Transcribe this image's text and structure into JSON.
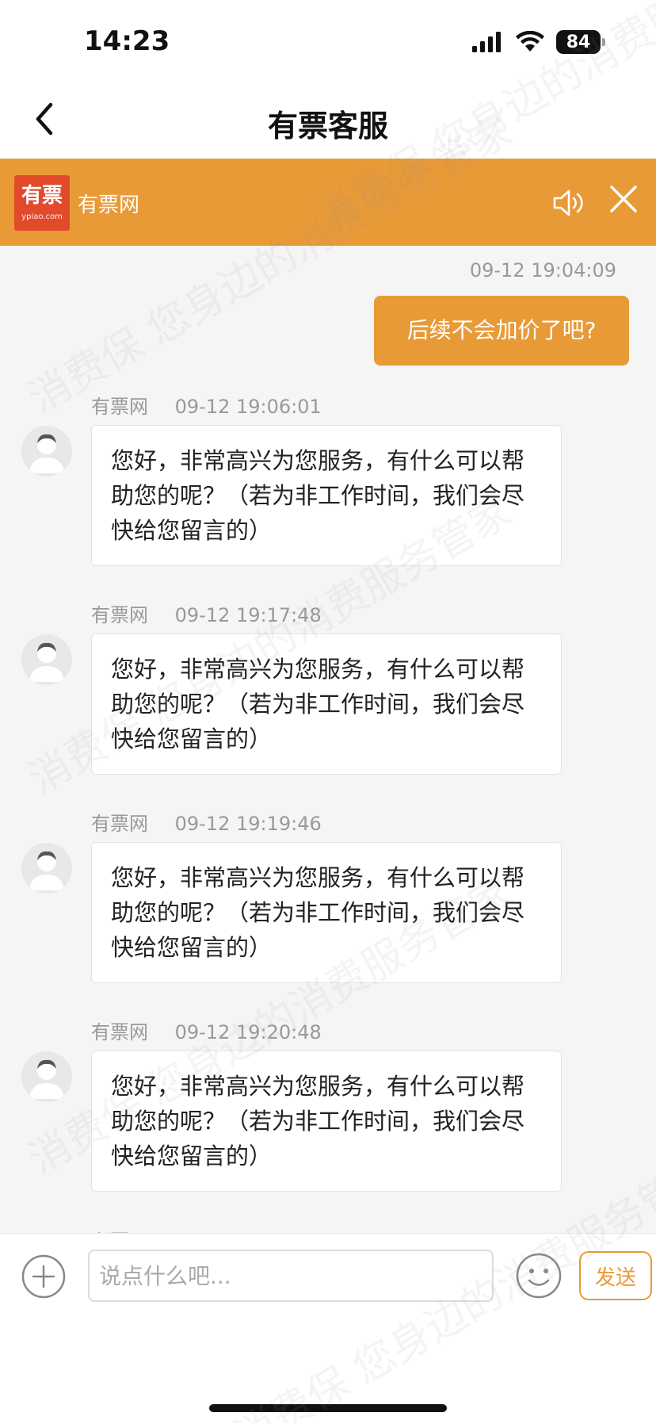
{
  "status": {
    "time": "14:23",
    "battery": "84"
  },
  "nav": {
    "title": "有票客服"
  },
  "banner": {
    "logo_text": "有票",
    "logo_sub": "ypiao.com",
    "name": "有票网"
  },
  "chat": {
    "own_message": {
      "time": "09-12 19:04:09",
      "text": "后续不会加价了吧?"
    },
    "replies": [
      {
        "sender": "有票网",
        "time": "09-12 19:06:01",
        "text": "您好，非常高兴为您服务，有什么可以帮助您的呢？（若为非工作时间，我们会尽快给您留言的）"
      },
      {
        "sender": "有票网",
        "time": "09-12 19:17:48",
        "text": "您好，非常高兴为您服务，有什么可以帮助您的呢？（若为非工作时间，我们会尽快给您留言的）"
      },
      {
        "sender": "有票网",
        "time": "09-12 19:19:46",
        "text": "您好，非常高兴为您服务，有什么可以帮助您的呢？（若为非工作时间，我们会尽快给您留言的）"
      },
      {
        "sender": "有票网",
        "time": "09-12 19:20:48",
        "text": "您好，非常高兴为您服务，有什么可以帮助您的呢？（若为非工作时间，我们会尽快给您留言的）"
      }
    ],
    "next_sender": "有票网"
  },
  "input": {
    "placeholder": "说点什么吧...",
    "send_label": "发送"
  },
  "watermark": {
    "lines": [
      "消费保 您身边的消费服务管家",
      "消费保 您身边的消费服务管家",
      "消费保 您身边的消费服务管家",
      "消费保 您身边的消费服务管家",
      "消费保 您身边的消费服务管家"
    ]
  },
  "colors": {
    "accent": "#e89a37",
    "logo_red": "#e24a2c",
    "background": "#f5f5f5"
  },
  "icons": {
    "back": "chevron-left-icon",
    "speaker": "speaker-icon",
    "close": "close-icon",
    "plus": "plus-circle-icon",
    "emoji": "smiley-icon"
  }
}
